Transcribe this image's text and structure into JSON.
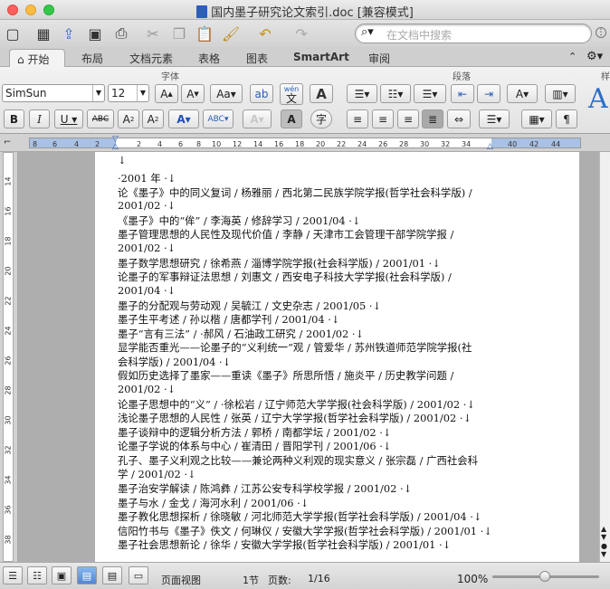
{
  "window": {
    "title": "国内墨子研究论文索引.doc [兼容模式]"
  },
  "toolbar": {
    "search_placeholder": "在文档中搜索"
  },
  "tabs": [
    {
      "label": "开始",
      "active": true
    },
    {
      "label": "布局"
    },
    {
      "label": "文档元素"
    },
    {
      "label": "表格"
    },
    {
      "label": "图表"
    },
    {
      "label": "SmartArt"
    },
    {
      "label": "审阅"
    }
  ],
  "ribbon": {
    "font_group": "字体",
    "paragraph_group": "段落",
    "style_group_partial": "样",
    "font_name": "SimSun",
    "font_size": "12",
    "phonetic_label": "wén",
    "phonetic_char": "文"
  },
  "ruler": {
    "numbers": [
      "8",
      "6",
      "4",
      "2",
      "2",
      "2",
      "4",
      "6",
      "8",
      "10",
      "12",
      "14",
      "16",
      "18",
      "20",
      "22",
      "24",
      "26",
      "28",
      "30",
      "32",
      "34",
      "36",
      "40",
      "42",
      "44"
    ]
  },
  "vruler": {
    "numbers": [
      "14",
      "16",
      "18",
      "20",
      "22",
      "24",
      "26",
      "28",
      "30",
      "32",
      "34",
      "36",
      "38"
    ]
  },
  "document": {
    "lines": [
      "↓",
      "·2001 年 ·↓",
      "论《墨子》中的同义复词 / 杨雅丽 / 西北第二民族学院学报(哲学社会科学版) /",
      "2001/02 ·↓",
      "《墨子》中的“侔” / 李海英 / 修辞学习 / 2001/04 ·↓",
      "墨子管理思想的人民性及现代价值 / 李静 / 天津市工会管理干部学院学报 /",
      "2001/02 ·↓",
      "墨子数学思想研究 / 徐希燕 / 淄博学院学报(社会科学版) / 2001/01 ·↓",
      "论墨子的军事辩证法思想 / 刘惠文 / 西安电子科技大学学报(社会科学版) /",
      "2001/04 ·↓",
      "墨子的分配观与劳动观 / 吴毓江 / 文史杂志 / 2001/05 ·↓",
      "墨子生平考述 / 孙以楷 / 唐都学刊 / 2001/04 ·↓",
      "墨子“言有三法” / ·郝风 / 石油政工研究 / 2001/02 ·↓",
      "显学能否重光——论墨子的“义利统一”观 / 管爱华 / 苏州铁道师范学院学报(社",
      "会科学版) / 2001/04 ·↓",
      "假如历史选择了墨家——重读《墨子》所思所悟 / 施炎平 / 历史教学问题 /",
      "2001/02 ·↓",
      "论墨子思想中的“义” / ·徐松岩 / 辽宁师范大学学报(社会科学版) / 2001/02 ·↓",
      "浅论墨子思想的人民性 / 张英 / 辽宁大学学报(哲学社会科学版) / 2001/02 ·↓",
      "墨子谈辩中的逻辑分析方法 / 郭桥 / 南都学坛 / 2001/02 ·↓",
      "论墨子学说的体系与中心 / 崔清田 / 晋阳学刊 / 2001/06 ·↓",
      "孔子、墨子义利观之比较——兼论两种义利观的现实意义 / 张宗磊 / 广西社会科",
      "学 / 2001/02 ·↓",
      "墨子治安学解读 / 陈鸿彝 / 江苏公安专科学校学报 / 2001/02 ·↓",
      "墨子与水 / 金戈 / 海河水利 / 2001/06 ·↓",
      "墨子教化思想探析 / 徐晓敏 / 河北师范大学学报(哲学社会科学版) / 2001/04 ·↓",
      "信阳竹书与《墨子》佚文 / 何琳仪 / 安徽大学学报(哲学社会科学版) / 2001/01 ·↓",
      "墨子社会思想新论 / 徐华 / 安徽大学学报(哲学社会科学版) / 2001/01 ·↓"
    ]
  },
  "status": {
    "view": "页面视图",
    "section": "1节",
    "page_label": "页数:",
    "page_value": "1/16",
    "zoom": "100%"
  }
}
